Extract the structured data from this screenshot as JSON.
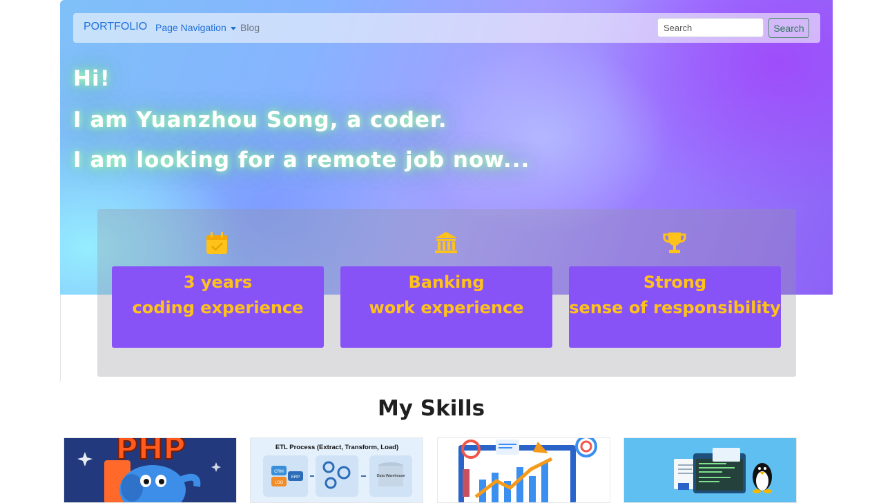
{
  "navbar": {
    "brand": "PORTFOLIO",
    "menu_dropdown": "Page Navigation",
    "menu_blog": "Blog",
    "search_placeholder": "Search",
    "search_button": "Search"
  },
  "hero": {
    "line1": "Hi!",
    "line2": "I am Yuanzhou Song, a coder.",
    "line3": "I am looking for a remote job now..."
  },
  "highlights": [
    {
      "icon": "calendar-check-icon",
      "line1": "3 years",
      "line2": "coding experience"
    },
    {
      "icon": "bank-icon",
      "line1": "Banking",
      "line2": "work experience"
    },
    {
      "icon": "trophy-icon",
      "line1": "Strong",
      "line2": "sense of responsibility"
    }
  ],
  "skills": {
    "title": "My Skills",
    "cards": [
      {
        "image": "php-elephant-image",
        "logo_text": "PHP"
      },
      {
        "image": "etl-process-image",
        "caption": "ETL Process (Extract, Transform, Load)",
        "labels": [
          "CRM",
          "LOG",
          "ERP",
          "Data Warehouse"
        ]
      },
      {
        "image": "data-analytics-image"
      },
      {
        "image": "linux-terminal-image"
      }
    ]
  },
  "colors": {
    "brand_blue": "#1e6fd9",
    "card_purple": "#8753f7",
    "card_text_gold": "#ffc21a",
    "search_button_green": "#2b7a5a"
  }
}
